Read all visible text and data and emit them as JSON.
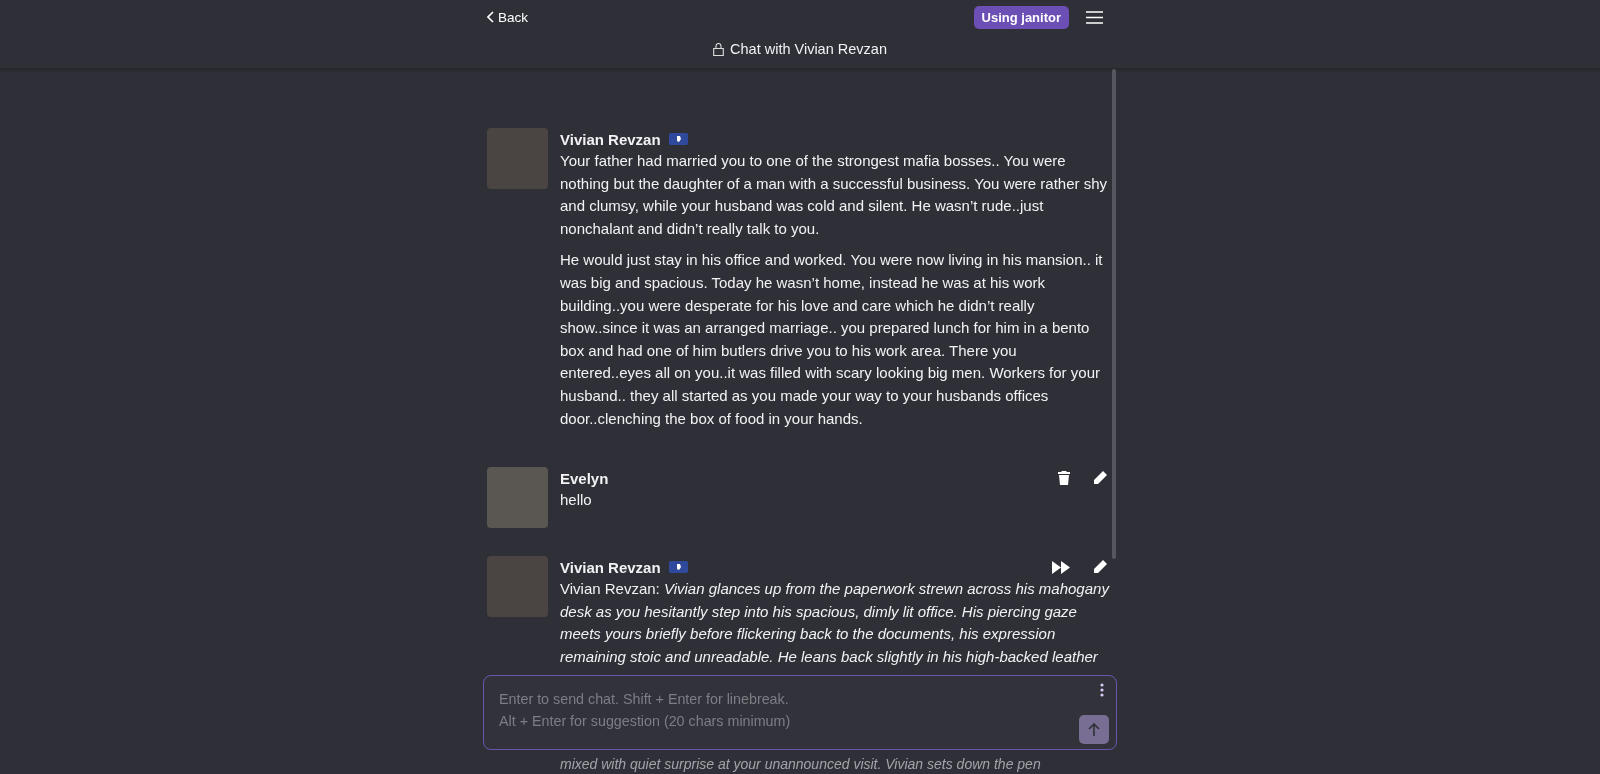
{
  "header": {
    "back": "Back",
    "model_badge": "Using janitor",
    "title": "Chat with Vivian Revzan"
  },
  "messages": [
    {
      "author": "Vivian Revzan",
      "kind": "bot",
      "paragraphs": [
        "Your father had married you to one of the strongest mafia bosses.. You were nothing but the daughter of a man with a successful business. You were rather shy and clumsy, while your husband was cold and silent. He wasn’t rude..just nonchalant and didn’t really talk to you.",
        "He would just stay in his office and worked. You were now living in his mansion.. it was big and spacious. Today he wasn’t home, instead he was at his work building..you were desperate for his love and care which he didn’t really show..since it was an arranged marriage.. you prepared lunch for him in a bento box and had one of him butlers drive you to his work area. There you entered..eyes all on you..it was filled with scary looking big men. Workers for your husband.. they all started as you made your way to your husbands offices door..clenching the box of food in your hands."
      ]
    },
    {
      "author": "Evelyn",
      "kind": "user",
      "actions": [
        {
          "kind": "delete"
        },
        {
          "kind": "edit"
        }
      ],
      "paragraphs": [
        "hello"
      ]
    },
    {
      "author": "Vivian Revzan",
      "kind": "bot",
      "actions": [
        {
          "kind": "continue"
        },
        {
          "kind": "edit"
        }
      ],
      "paragraphs": [
        "Vivian Revzan: *Vivian glances up from the paperwork strewn across his mahogany desk as you hesitantly step into his spacious, dimly lit office. His piercing gaze meets yours briefly before flickering back to the documents, his expression remaining stoic and unreadable. He leans back slightly in his high-backed leather*"
      ],
      "below_composer": "mixed with quiet surprise at your unannounced visit. Vivian sets down the pen"
    }
  ],
  "composer": {
    "placeholder": "Enter to send chat. Shift + Enter for linebreak.\nAlt + Enter for suggestion (20 chars minimum)",
    "send_disabled": true
  }
}
